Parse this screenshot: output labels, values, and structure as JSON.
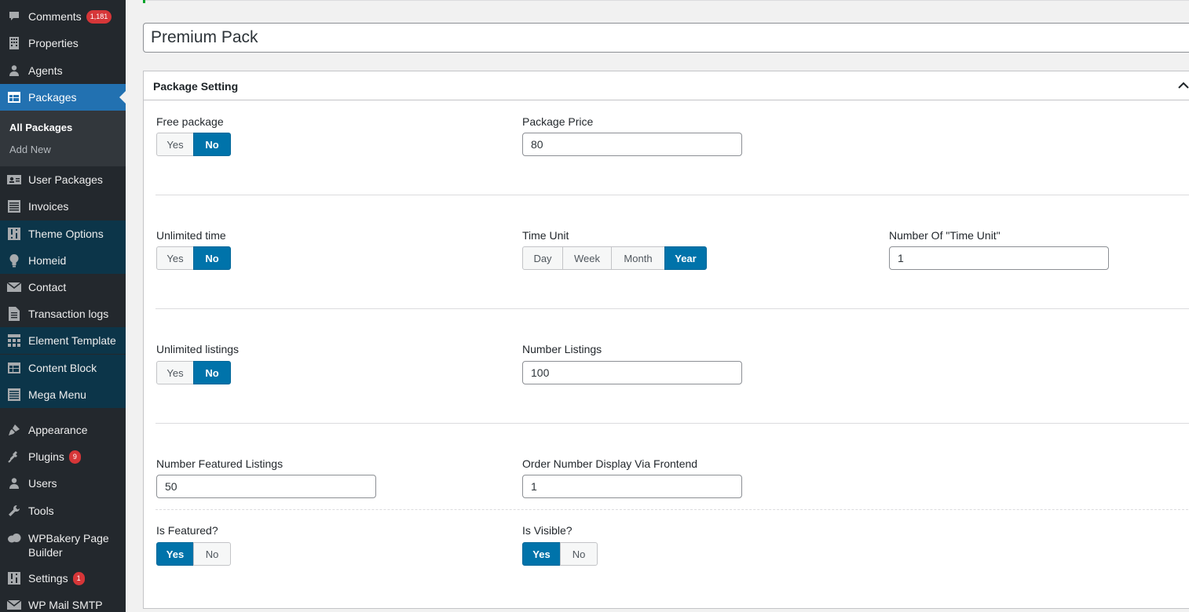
{
  "sidebar": {
    "items": [
      {
        "label": "Comments",
        "icon": "comment-icon",
        "badge": "1,181"
      },
      {
        "label": "Properties",
        "icon": "building-icon"
      },
      {
        "label": "Agents",
        "icon": "person-icon"
      },
      {
        "label": "Packages",
        "icon": "table-icon"
      },
      {
        "label": "User Packages",
        "icon": "id-card-icon"
      },
      {
        "label": "Invoices",
        "icon": "list-icon"
      },
      {
        "label": "Theme Options",
        "icon": "sliders-icon"
      },
      {
        "label": "Homeid",
        "icon": "lightbulb-icon"
      },
      {
        "label": "Contact",
        "icon": "envelope-icon"
      },
      {
        "label": "Transaction logs",
        "icon": "document-icon"
      },
      {
        "label": "Element Template",
        "icon": "layout-icon"
      },
      {
        "label": "Content Block",
        "icon": "table-icon"
      },
      {
        "label": "Mega Menu",
        "icon": "list-icon"
      },
      {
        "label": "Appearance",
        "icon": "brush-icon"
      },
      {
        "label": "Plugins",
        "icon": "plug-icon",
        "badge": "9"
      },
      {
        "label": "Users",
        "icon": "users-icon"
      },
      {
        "label": "Tools",
        "icon": "wrench-icon"
      },
      {
        "label": "WPBakery Page Builder",
        "icon": "cloud-icon"
      },
      {
        "label": "Settings",
        "icon": "settings-sliders-icon",
        "badge": "1"
      },
      {
        "label": "WP Mail SMTP",
        "icon": "mail-icon"
      }
    ],
    "submenu": {
      "all_packages": "All Packages",
      "add_new": "Add New"
    }
  },
  "post": {
    "title": "Premium Pack"
  },
  "panel": {
    "title": "Package Setting",
    "free_package": {
      "label": "Free package",
      "yes": "Yes",
      "no": "No",
      "selected": "No"
    },
    "package_price": {
      "label": "Package Price",
      "value": "80"
    },
    "unlimited_time": {
      "label": "Unlimited time",
      "yes": "Yes",
      "no": "No",
      "selected": "No"
    },
    "time_unit": {
      "label": "Time Unit",
      "options": [
        "Day",
        "Week",
        "Month",
        "Year"
      ],
      "selected": "Year"
    },
    "number_time_unit": {
      "label": "Number Of \"Time Unit\"",
      "value": "1"
    },
    "unlimited_listings": {
      "label": "Unlimited listings",
      "yes": "Yes",
      "no": "No",
      "selected": "No"
    },
    "number_listings": {
      "label": "Number Listings",
      "value": "100"
    },
    "featured_listings": {
      "label": "Number Featured Listings",
      "value": "50"
    },
    "order_number": {
      "label": "Order Number Display Via Frontend",
      "value": "1"
    },
    "is_featured": {
      "label": "Is Featured?",
      "yes": "Yes",
      "no": "No",
      "selected": "Yes"
    },
    "is_visible": {
      "label": "Is Visible?",
      "yes": "Yes",
      "no": "No",
      "selected": "Yes"
    }
  },
  "colors": {
    "accent": "#0073aa",
    "sidebar": "#23282d",
    "active_menu": "#2271b1",
    "badge": "#d63638"
  }
}
